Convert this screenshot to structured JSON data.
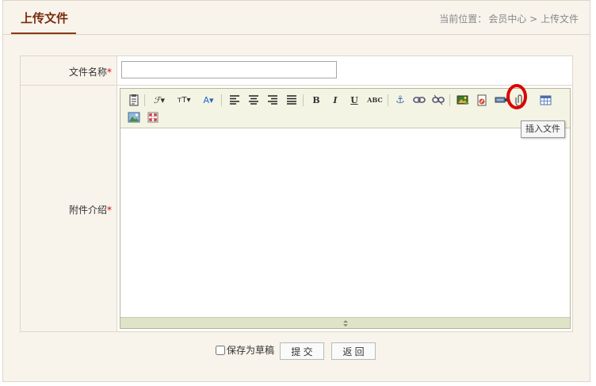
{
  "header": {
    "title": "上传文件",
    "breadcrumb_label": "当前位置：",
    "breadcrumb_path": "会员中心 > 上传文件"
  },
  "form": {
    "name_label": "文件名称",
    "name_value": "",
    "desc_label": "附件介绍",
    "required_mark": "*"
  },
  "editor": {
    "toolbar_row1": [
      {
        "name": "source-icon"
      },
      {
        "name": "font-family-icon",
        "glyph": "ℱ▾"
      },
      {
        "name": "font-size-icon",
        "glyph": "тT▾"
      },
      {
        "name": "font-color-icon",
        "glyph": "A▾"
      },
      {
        "name": "align-left-icon"
      },
      {
        "name": "align-center-icon"
      },
      {
        "name": "align-right-icon"
      },
      {
        "name": "align-justify-icon"
      },
      {
        "name": "bold-icon",
        "glyph": "B"
      },
      {
        "name": "italic-icon",
        "glyph": "I"
      },
      {
        "name": "underline-icon",
        "glyph": "U"
      },
      {
        "name": "strikethrough-icon",
        "glyph": "ABC"
      },
      {
        "name": "anchor-icon",
        "glyph": "⚓"
      },
      {
        "name": "link-icon"
      },
      {
        "name": "unlink-icon"
      },
      {
        "name": "insert-image-icon"
      },
      {
        "name": "insert-flash-icon"
      },
      {
        "name": "insert-media-icon"
      },
      {
        "name": "insert-file-icon"
      },
      {
        "name": "insert-table-icon"
      }
    ],
    "tooltip": "插入文件",
    "accent_highlight": "#dd0000"
  },
  "actions": {
    "draft_label": "保存为草稿",
    "draft_checked": false,
    "submit_label": "提 交",
    "back_label": "返 回"
  }
}
